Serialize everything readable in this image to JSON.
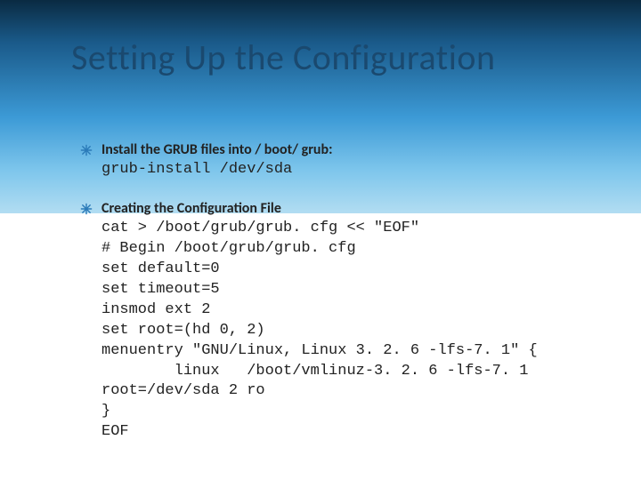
{
  "title": "Setting Up the Configuration",
  "items": [
    {
      "heading": "Install the GRUB files into / boot/ grub:",
      "code": "grub-install /dev/sda"
    },
    {
      "heading": "Creating the Configuration File",
      "code": "cat > /boot/grub/grub. cfg << \"EOF\"\n# Begin /boot/grub/grub. cfg\nset default=0\nset timeout=5\ninsmod ext 2\nset root=(hd 0, 2)\nmenuentry \"GNU/Linux, Linux 3. 2. 6 -lfs-7. 1\" {\n        linux   /boot/vmlinuz-3. 2. 6 -lfs-7. 1\nroot=/dev/sda 2 ro\n}\nEOF"
    }
  ]
}
